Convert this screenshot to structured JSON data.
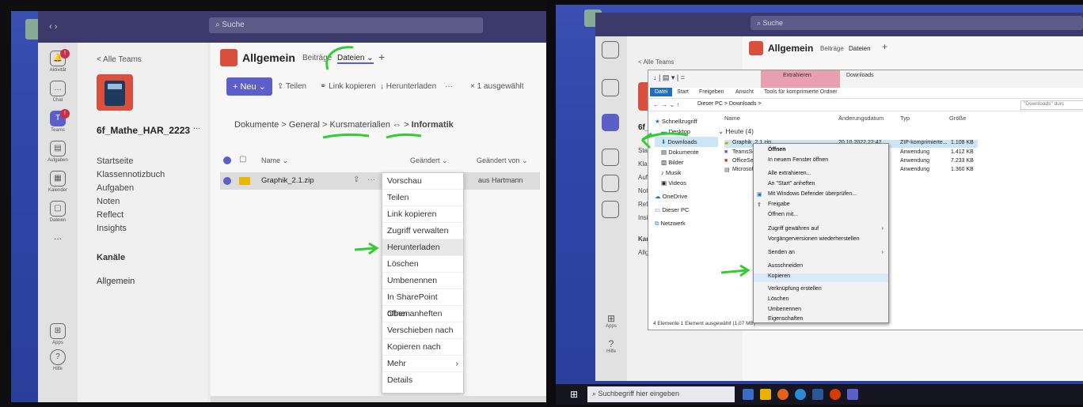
{
  "left": {
    "search_placeholder": "Suche",
    "rail": [
      {
        "label": "Aktivität",
        "icon": "bell-icon"
      },
      {
        "label": "Chat",
        "icon": "chat-icon"
      },
      {
        "label": "Teams",
        "icon": "teams-icon"
      },
      {
        "label": "Aufgaben",
        "icon": "assignments-icon"
      },
      {
        "label": "Kalender",
        "icon": "calendar-icon"
      },
      {
        "label": "Dateien",
        "icon": "files-icon"
      },
      {
        "label": "...",
        "icon": "more-icon"
      },
      {
        "label": "Apps",
        "icon": "apps-icon"
      },
      {
        "label": "Hilfe",
        "icon": "help-icon"
      }
    ],
    "back_link": "< Alle Teams",
    "team_name": "6f_Mathe_HAR_2223",
    "team_more": "...",
    "nav_items": [
      "Startseite",
      "Klassennotizbuch",
      "Aufgaben",
      "Noten",
      "Reflect",
      "Insights"
    ],
    "channels_header": "Kanäle",
    "channels": [
      "Allgemein"
    ],
    "channel_title": "Allgemein",
    "tabs": [
      "Beiträge",
      "Dateien",
      "+"
    ],
    "toolbar": {
      "new": "+ Neu",
      "share": "Teilen",
      "copy_link": "Link kopieren",
      "download": "Herunterladen",
      "more": "···",
      "selected": "× 1 ausgewählt"
    },
    "breadcrumb": [
      "Dokumente",
      ">",
      "General",
      ">",
      "Kursmaterialien",
      "⇔",
      ">",
      "Informatik"
    ],
    "columns": [
      "Name",
      "Geändert",
      "Geändert von"
    ],
    "file_name": "Graphik_2.1.zip",
    "file_author": "aus Hartmann",
    "context_menu": [
      "Vorschau",
      "Teilen",
      "Link kopieren",
      "Zugriff verwalten",
      "Herunterladen",
      "Löschen",
      "Umbenennen",
      "In SharePoint öffnen",
      "Oben anheften",
      "Verschieben nach",
      "Kopieren nach",
      "Mehr",
      "Details"
    ]
  },
  "right": {
    "search_placeholder": "Suche",
    "back_link": "< Alle Teams",
    "channel_title": "Allgemein",
    "tabs": [
      "Beiträge",
      "Dateien",
      "+"
    ],
    "team_short": "6f_",
    "side_partial": [
      "Star",
      "Klas",
      "Aufg",
      "Not",
      "Refl",
      "Insi",
      "Kan",
      "Allg"
    ],
    "ribbon_tabs": [
      "Datei",
      "Start",
      "Freigeben",
      "Ansicht",
      "Tools für komprimierte Ordner"
    ],
    "ribbon_extract": "Extrahieren",
    "ribbon_downloads": "Downloads",
    "address": "Dieser PC  >  Downloads  >",
    "search_box": "\"Downloads\" durc",
    "nav_pane": [
      "Schnellzugriff",
      "Desktop",
      "Downloads",
      "Dokumente",
      "Bilder",
      "Musik",
      "Videos",
      "OneDrive",
      "Dieser PC",
      "Netzwerk"
    ],
    "columns": [
      "Name",
      "Änderungsdatum",
      "Typ",
      "Größe"
    ],
    "group": "Heute (4)",
    "files": [
      {
        "name": "Graphik_2.1.zip",
        "date": "20.10.2022 22:42",
        "type": "ZIP-komprimierte...",
        "size": "1.108 KB"
      },
      {
        "name": "TeamsSe",
        "date": "",
        "type": "Anwendung",
        "size": "1.412 KB"
      },
      {
        "name": "OfficeSe",
        "date": "",
        "type": "Anwendung",
        "size": "7.233 KB"
      },
      {
        "name": "Microsoft",
        "date": "",
        "type": "Anwendung",
        "size": "1.360 KB"
      }
    ],
    "status": "4 Elemente    1 Element ausgewählt (1,07 MB)",
    "context_menu": [
      "Öffnen",
      "In neuem Fenster öffnen",
      "Alle extrahieren...",
      "An \"Start\" anheften",
      "Mit Windows Defender überprüfen...",
      "Freigabe",
      "Öffnen mit...",
      "Zugriff gewähren auf",
      "Vorgängerversionen wiederherstellen",
      "Senden an",
      "Ausschneiden",
      "Kopieren",
      "Verknüpfung erstellen",
      "Löschen",
      "Umbenennen",
      "Eigenschaften"
    ],
    "taskbar_search": "Suchbegriff hier eingeben",
    "rail_apps": "Apps",
    "rail_help": "Hilfe"
  },
  "annotation_color": "#33cc33",
  "accent": "#5b5fc7"
}
